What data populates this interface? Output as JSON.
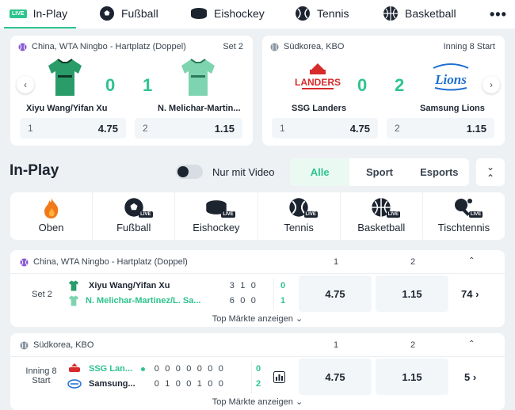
{
  "nav": {
    "live_badge": "LIVE",
    "items": [
      {
        "label": "In-Play",
        "icon": "live-icon"
      },
      {
        "label": "Fußball",
        "icon": "soccer-ball-icon"
      },
      {
        "label": "Eishockey",
        "icon": "hockey-puck-icon"
      },
      {
        "label": "Tennis",
        "icon": "tennis-ball-icon"
      },
      {
        "label": "Basketball",
        "icon": "basketball-icon"
      }
    ],
    "more": "•••"
  },
  "featured": [
    {
      "league": "China, WTA Ningbo - Hartplatz (Doppel)",
      "status": "Set 2",
      "home": {
        "name": "Xiyu Wang/Yifan Xu",
        "score": "0"
      },
      "away": {
        "name": "N. Melichar-Martin...",
        "score": "1"
      },
      "odds": [
        {
          "label": "1",
          "value": "4.75"
        },
        {
          "label": "2",
          "value": "1.15"
        }
      ]
    },
    {
      "league": "Südkorea, KBO",
      "status": "Inning 8 Start",
      "home": {
        "name": "SSG Landers",
        "score": "0",
        "logo_text": "LANDERS"
      },
      "away": {
        "name": "Samsung Lions",
        "score": "2",
        "logo_text": "Lions"
      },
      "odds": [
        {
          "label": "1",
          "value": "4.75"
        },
        {
          "label": "2",
          "value": "1.15"
        }
      ]
    }
  ],
  "inplay": {
    "title": "In-Play",
    "video_toggle": "Nur mit Video",
    "filters": [
      "Alle",
      "Sport",
      "Esports"
    ],
    "live_badge": "LIVE",
    "sports": [
      {
        "label": "Oben",
        "icon": "flame-icon"
      },
      {
        "label": "Fußball",
        "icon": "soccer-ball-icon"
      },
      {
        "label": "Eishockey",
        "icon": "hockey-puck-icon"
      },
      {
        "label": "Tennis",
        "icon": "tennis-ball-icon"
      },
      {
        "label": "Basketball",
        "icon": "basketball-icon"
      },
      {
        "label": "Tischtennis",
        "icon": "table-tennis-icon"
      }
    ]
  },
  "matches": [
    {
      "league": "China, WTA Ningbo - Hartplatz (Doppel)",
      "col1": "1",
      "col2": "2",
      "status": "Set 2",
      "home": {
        "name": "Xiyu Wang/Yifan Xu",
        "digits": [
          "3",
          "1",
          "0"
        ],
        "live": "0"
      },
      "away": {
        "name": "N. Melichar-Martinez/L. Sa...",
        "digits": [
          "6",
          "0",
          "0"
        ],
        "live": "1"
      },
      "odds": [
        "4.75",
        "1.15"
      ],
      "more": "74",
      "top_markets": "Top Märkte anzeigen"
    },
    {
      "league": "Südkorea, KBO",
      "col1": "1",
      "col2": "2",
      "status": "Inning 8 Start",
      "home": {
        "name": "SSG Lan...",
        "digits": [
          "0",
          "0",
          "0",
          "0",
          "0",
          "0",
          "0"
        ],
        "live": "0"
      },
      "away": {
        "name": "Samsung...",
        "digits": [
          "0",
          "1",
          "0",
          "0",
          "1",
          "0",
          "0"
        ],
        "live": "2"
      },
      "odds": [
        "4.75",
        "1.15"
      ],
      "more": "5",
      "top_markets": "Top Märkte anzeigen"
    }
  ],
  "colors": {
    "accent": "#2ec48e",
    "text": "#1c2430",
    "background": "#eef1f4"
  }
}
